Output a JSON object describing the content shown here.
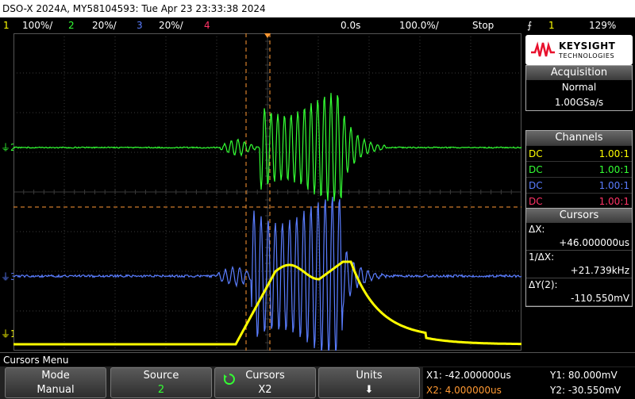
{
  "title": "DSO-X 2024A, MY58104593: Tue Apr 23 23:33:38 2024",
  "status": {
    "ch1_num": "1",
    "ch1_scale": "100%/",
    "ch2_num": "2",
    "ch2_scale": "20%/",
    "ch3_num": "3",
    "ch3_scale": "20%/",
    "ch4_num": "4",
    "time_delay": "0.0s",
    "time_scale": "100.0%/",
    "run_state": "Stop",
    "trigger_symbol": "⨍",
    "trigger_source": "1",
    "trigger_level": "129%"
  },
  "colors": {
    "ch1": "#ffff00",
    "ch2": "#33ff33",
    "ch3": "#5a7dff",
    "ch4": "#ff3366",
    "cursor": "#ff9933",
    "grid": "#3a3a3a"
  },
  "markers": {
    "ch2": "2",
    "ch3": "3",
    "ch1": "1"
  },
  "logo": {
    "line1": "KEYSIGHT",
    "line2": "TECHNOLOGIES"
  },
  "acquisition": {
    "header": "Acquisition",
    "mode": "Normal",
    "rate": "1.00GSa/s"
  },
  "channels": {
    "header": "Channels",
    "rows": [
      {
        "coupling": "DC",
        "probe": "1.00:1"
      },
      {
        "coupling": "DC",
        "probe": "1.00:1"
      },
      {
        "coupling": "DC",
        "probe": "1.00:1"
      },
      {
        "coupling": "DC",
        "probe": "1.00:1"
      }
    ]
  },
  "cursors": {
    "header": "Cursors",
    "dx_label": "ΔX:",
    "dx_value": "+46.000000us",
    "inv_dx_label": "1/ΔX:",
    "inv_dx_value": "+21.739kHz",
    "dy_label": "ΔY(2):",
    "dy_value": "-110.550mV"
  },
  "menu": {
    "title": "Cursors Menu",
    "keys": [
      {
        "label": "Mode",
        "value": "Manual"
      },
      {
        "label": "Source",
        "value": "2"
      },
      {
        "label": "Cursors",
        "value": "X2"
      },
      {
        "label": "Units",
        "value": "⬇"
      }
    ]
  },
  "readouts": {
    "x1": "X1: -42.000000us",
    "x2": "X2: 4.000000us",
    "y1": "Y1: 80.000mV",
    "y2": "Y2: -30.550mV"
  }
}
